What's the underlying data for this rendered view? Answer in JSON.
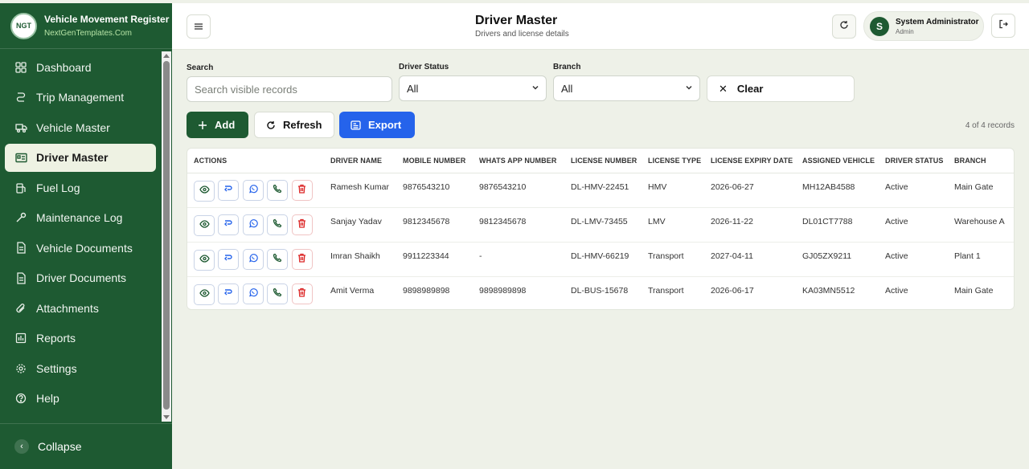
{
  "app": {
    "logo_text": "NGT",
    "title": "Vehicle Movement Register",
    "subtitle": "NextGenTemplates.Com"
  },
  "sidebar": {
    "items": [
      {
        "label": "Dashboard",
        "icon": "grid-icon",
        "active": false
      },
      {
        "label": "Trip Management",
        "icon": "route-icon",
        "active": false
      },
      {
        "label": "Vehicle Master",
        "icon": "truck-icon",
        "active": false
      },
      {
        "label": "Driver Master",
        "icon": "id-card-icon",
        "active": true
      },
      {
        "label": "Fuel Log",
        "icon": "fuel-icon",
        "active": false
      },
      {
        "label": "Maintenance Log",
        "icon": "wrench-icon",
        "active": false
      },
      {
        "label": "Vehicle Documents",
        "icon": "document-icon",
        "active": false
      },
      {
        "label": "Driver Documents",
        "icon": "document-icon",
        "active": false
      },
      {
        "label": "Attachments",
        "icon": "paperclip-icon",
        "active": false
      },
      {
        "label": "Reports",
        "icon": "bar-chart-icon",
        "active": false
      },
      {
        "label": "Settings",
        "icon": "gear-icon",
        "active": false
      },
      {
        "label": "Help",
        "icon": "help-icon",
        "active": false
      }
    ],
    "collapse_label": "Collapse"
  },
  "header": {
    "title": "Driver Master",
    "subtitle": "Drivers and license details",
    "user_initial": "S",
    "user_name": "System Administrator",
    "user_role": "Admin"
  },
  "filters": {
    "search_label": "Search",
    "search_placeholder": "Search visible records",
    "status_label": "Driver Status",
    "status_value": "All",
    "branch_label": "Branch",
    "branch_value": "All",
    "clear_label": "Clear"
  },
  "toolbar": {
    "add_label": "Add",
    "refresh_label": "Refresh",
    "export_label": "Export",
    "record_count": "4 of 4 records"
  },
  "table": {
    "columns": [
      "ACTIONS",
      "DRIVER NAME",
      "MOBILE NUMBER",
      "WHATS APP NUMBER",
      "LICENSE NUMBER",
      "LICENSE TYPE",
      "LICENSE EXPIRY DATE",
      "ASSIGNED VEHICLE",
      "DRIVER STATUS",
      "BRANCH"
    ],
    "rows": [
      {
        "driver_name": "Ramesh Kumar",
        "mobile": "9876543210",
        "whatsapp": "9876543210",
        "license_no": "DL-HMV-22451",
        "license_type": "HMV",
        "expiry": "2026-06-27",
        "vehicle": "MH12AB4588",
        "status": "Active",
        "branch": "Main Gate"
      },
      {
        "driver_name": "Sanjay Yadav",
        "mobile": "9812345678",
        "whatsapp": "9812345678",
        "license_no": "DL-LMV-73455",
        "license_type": "LMV",
        "expiry": "2026-11-22",
        "vehicle": "DL01CT7788",
        "status": "Active",
        "branch": "Warehouse A"
      },
      {
        "driver_name": "Imran Shaikh",
        "mobile": "9911223344",
        "whatsapp": "-",
        "license_no": "DL-HMV-66219",
        "license_type": "Transport",
        "expiry": "2027-04-11",
        "vehicle": "GJ05ZX9211",
        "status": "Active",
        "branch": "Plant 1"
      },
      {
        "driver_name": "Amit Verma",
        "mobile": "9898989898",
        "whatsapp": "9898989898",
        "license_no": "DL-BUS-15678",
        "license_type": "Transport",
        "expiry": "2026-06-17",
        "vehicle": "KA03MN5512",
        "status": "Active",
        "branch": "Main Gate"
      }
    ]
  },
  "colors": {
    "sidebar_bg": "#1e5a32",
    "page_bg": "#eef1e8",
    "primary": "#1e5a32",
    "export": "#2563eb",
    "danger": "#dc2626"
  }
}
